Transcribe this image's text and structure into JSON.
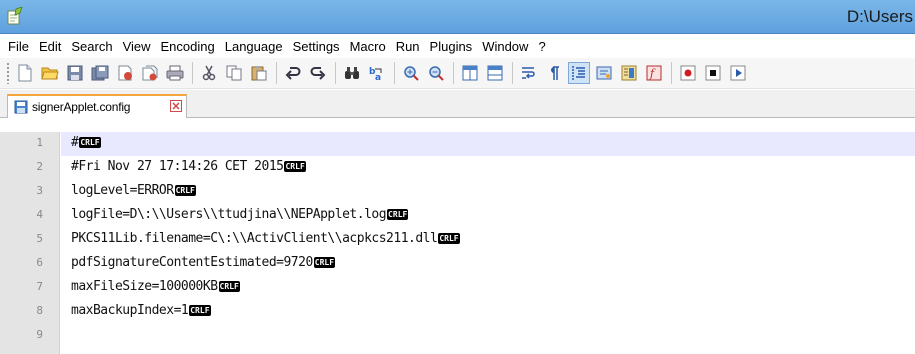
{
  "window": {
    "title": "D:\\Users"
  },
  "menu": [
    "File",
    "Edit",
    "Search",
    "View",
    "Encoding",
    "Language",
    "Settings",
    "Macro",
    "Run",
    "Plugins",
    "Window",
    "?"
  ],
  "toolbar": {
    "buttons": [
      "new-file",
      "open-file",
      "save",
      "save-all",
      "close",
      "close-all",
      "print",
      "cut",
      "copy",
      "paste",
      "undo",
      "redo",
      "find",
      "replace",
      "zoom-in",
      "zoom-out",
      "sync-vertical",
      "sync-horizontal",
      "word-wrap",
      "show-all-characters",
      "indent-guide",
      "user-defined-language",
      "doc-map",
      "record-macro",
      "stop-recording",
      "play-macro"
    ],
    "active_button": "show-all-characters"
  },
  "tabs": [
    {
      "label": "signerApplet.config",
      "active": true
    }
  ],
  "editor": {
    "eol_label_cr": "CR",
    "eol_label_lf": "LF",
    "lines": [
      {
        "number": "1",
        "text": "#"
      },
      {
        "number": "2",
        "text": "#Fri Nov 27 17:14:26 CET 2015"
      },
      {
        "number": "3",
        "text": "logLevel=ERROR"
      },
      {
        "number": "4",
        "text": "logFile=D\\:\\\\Users\\\\ttudjina\\\\NEPApplet.log"
      },
      {
        "number": "5",
        "text": "PKCS11Lib.filename=C\\:\\\\ActivClient\\\\acpkcs211.dll"
      },
      {
        "number": "6",
        "text": "pdfSignatureContentEstimated=9720"
      },
      {
        "number": "7",
        "text": "maxFileSize=100000KB"
      },
      {
        "number": "8",
        "text": "maxBackupIndex=1"
      },
      {
        "number": "9",
        "text": ""
      }
    ],
    "current_line": "1"
  },
  "colors": {
    "title_bar": "#6aa9e2",
    "current_line": "#e8e8ff",
    "tab_accent": "#f5a53d",
    "gutter": "#e4e4e4"
  }
}
